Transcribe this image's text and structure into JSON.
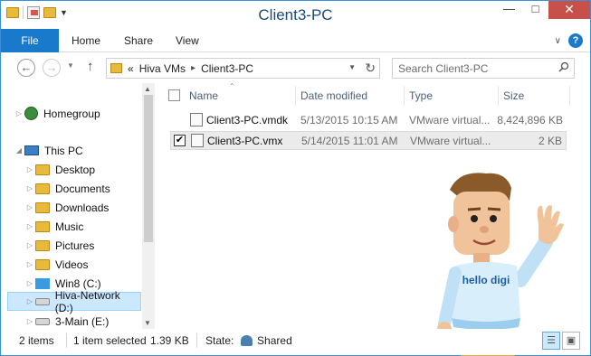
{
  "window": {
    "title": "Client3-PC"
  },
  "quick_access": {
    "icons": [
      "folder-icon",
      "properties-icon",
      "new-folder-icon",
      "customize-dropdown-icon"
    ]
  },
  "window_buttons": {
    "minimize": "—",
    "maximize": "□",
    "close": "✕"
  },
  "ribbon": {
    "tabs": [
      {
        "label": "File"
      },
      {
        "label": "Home"
      },
      {
        "label": "Share"
      },
      {
        "label": "View"
      }
    ],
    "help": "?"
  },
  "address": {
    "overflow": "«",
    "crumbs": [
      "Hiva VMs",
      "Client3-PC"
    ],
    "search_placeholder": "Search Client3-PC"
  },
  "nav_pane": {
    "items": [
      {
        "label": "Homegroup",
        "icon": "homegroup-icon"
      },
      {
        "label": "This PC",
        "icon": "pc-icon"
      },
      {
        "label": "Desktop",
        "icon": "folder-icon"
      },
      {
        "label": "Documents",
        "icon": "folder-icon"
      },
      {
        "label": "Downloads",
        "icon": "folder-icon"
      },
      {
        "label": "Music",
        "icon": "music-folder-icon"
      },
      {
        "label": "Pictures",
        "icon": "folder-icon"
      },
      {
        "label": "Videos",
        "icon": "folder-icon"
      },
      {
        "label": "Win8 (C:)",
        "icon": "windows-drive-icon"
      },
      {
        "label": "Hiva-Network (D:)",
        "icon": "drive-icon"
      },
      {
        "label": "3-Main (E:)",
        "icon": "drive-icon"
      }
    ]
  },
  "columns": {
    "name": "Name",
    "date": "Date modified",
    "type": "Type",
    "size": "Size"
  },
  "files": [
    {
      "name": "Client3-PC.vmdk",
      "date": "5/13/2015 10:15 AM",
      "type": "VMware virtual...",
      "size": "8,424,896 KB",
      "checked": false
    },
    {
      "name": "Client3-PC.vmx",
      "date": "5/14/2015 11:01 AM",
      "type": "VMware virtual...",
      "size": "2 KB",
      "checked": true,
      "check_mark": "✔"
    }
  ],
  "mascot": {
    "shirt_text": "hello digi"
  },
  "status": {
    "items": "2 items",
    "selected": "1 item selected",
    "size": "1.39 KB",
    "state_label": "State:",
    "state_value": "Shared"
  },
  "colors": {
    "accent": "#1979ca",
    "close": "#c7504a",
    "selection": "#cce8ff"
  }
}
